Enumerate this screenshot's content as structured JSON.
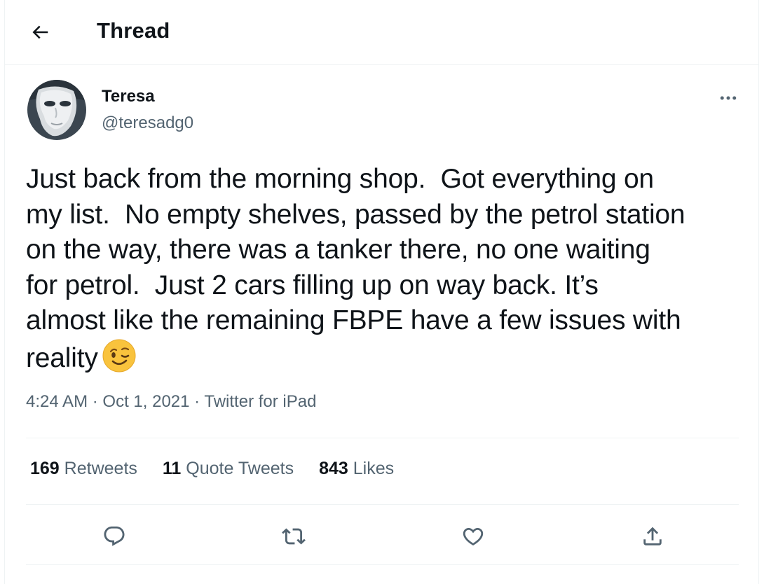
{
  "header": {
    "title": "Thread",
    "back_icon": "arrow-left-icon"
  },
  "tweet": {
    "author_name": "Teresa",
    "author_handle": "@teresadg0",
    "text": "Just back from the morning shop.  Got everything on\nmy list.  No empty shelves, passed by the petrol station\non the way, there was a tanker there, no one waiting\nfor petrol.  Just 2 cars filling up on way back. It’s\nalmost like the remaining FBPE have a few issues with\nreality",
    "emoji": "winking-face",
    "time": "4:24 AM",
    "date": "Oct 1, 2021",
    "source": "Twitter for iPad",
    "separator": "·"
  },
  "stats": {
    "retweets_count": "169",
    "retweets_label": "Retweets",
    "quotes_count": "11",
    "quotes_label": "Quote Tweets",
    "likes_count": "843",
    "likes_label": "Likes"
  },
  "actions": {
    "icons": [
      "reply-icon",
      "retweet-icon",
      "like-icon",
      "share-icon"
    ]
  },
  "colors": {
    "text_primary": "#0f1419",
    "text_secondary": "#536471",
    "divider": "#eff3f4",
    "emoji_yellow": "#f9c33d"
  }
}
